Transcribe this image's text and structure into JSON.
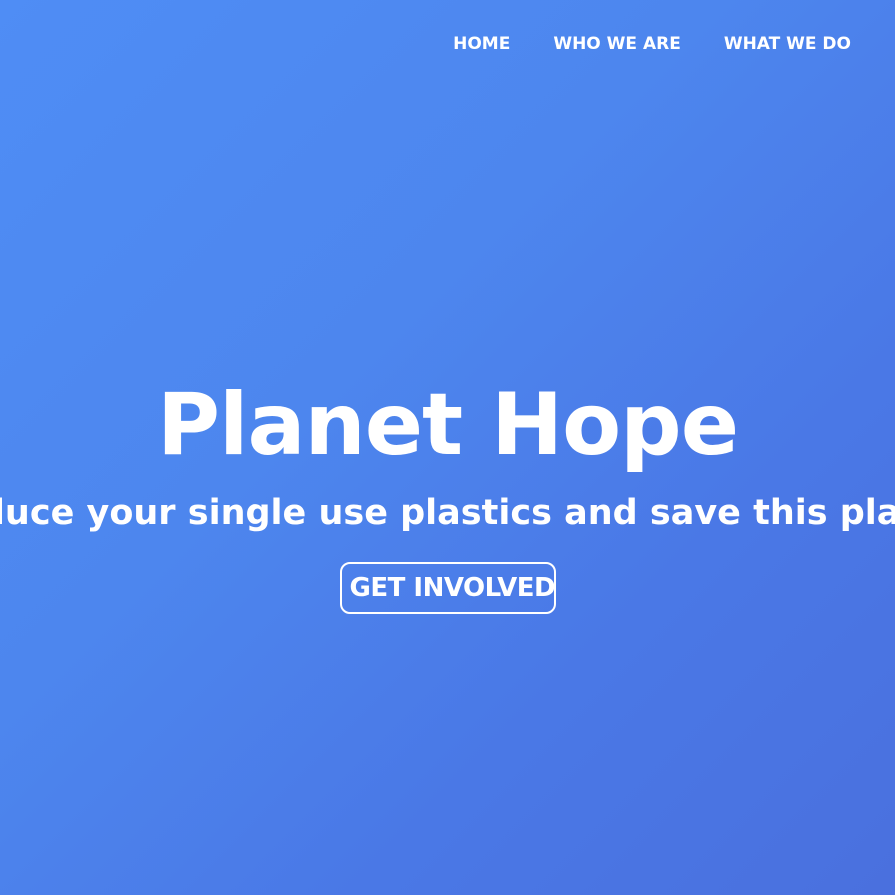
{
  "nav": {
    "items": [
      {
        "label": "HOME"
      },
      {
        "label": "WHO WE ARE"
      },
      {
        "label": "WHAT WE DO"
      }
    ]
  },
  "hero": {
    "title": "Planet Hope",
    "subtitle": "Reduce your single use plastics and save this planet",
    "cta_label": "GET INVOLVED"
  },
  "colors": {
    "background_gradient": [
      "#4f8df5",
      "#4a70de"
    ],
    "text": "#ffffff"
  }
}
